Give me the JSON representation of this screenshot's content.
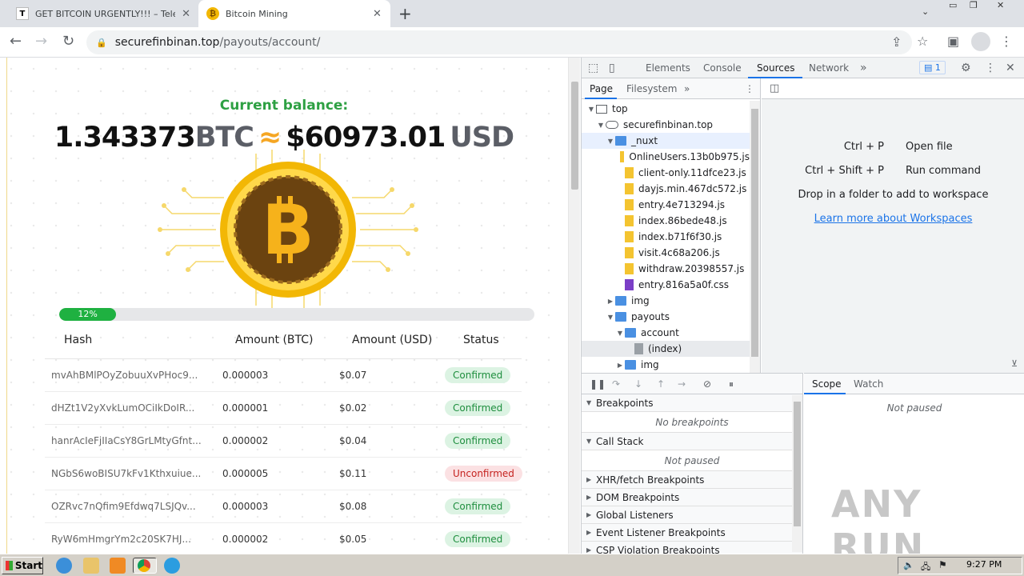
{
  "browser": {
    "tabs": [
      {
        "title": "GET BITCOIN URGENTLY!!! – Telegra",
        "favicon": "T"
      },
      {
        "title": "Bitcoin Mining",
        "favicon": "₿"
      }
    ],
    "url_host": "securefinbinan.top",
    "url_path": "/payouts/account/"
  },
  "page": {
    "balance_label": "Current balance:",
    "btc_amount": "1.343373",
    "btc_unit": "BTC",
    "approx": "≈",
    "usd_amount": "$60973.01",
    "usd_unit": "USD",
    "progress_label": "12%",
    "progress_fraction": 0.12,
    "table": {
      "headers": [
        "Hash",
        "Amount (BTC)",
        "Amount (USD)",
        "Status"
      ],
      "rows": [
        {
          "hash": "mvAhBMlPOyZobuuXvPHoc9...",
          "btc": "0.000003",
          "usd": "$0.07",
          "status": "Confirmed",
          "ok": true
        },
        {
          "hash": "dHZt1V2yXvkLumOCiIkDoIR...",
          "btc": "0.000001",
          "usd": "$0.02",
          "status": "Confirmed",
          "ok": true
        },
        {
          "hash": "hanrAcIeFjIIaCsY8GrLMtyGfnt...",
          "btc": "0.000002",
          "usd": "$0.04",
          "status": "Confirmed",
          "ok": true
        },
        {
          "hash": "NGbS6woBISU7kFv1Kthxuiue...",
          "btc": "0.000005",
          "usd": "$0.11",
          "status": "Unconfirmed",
          "ok": false
        },
        {
          "hash": "OZRvc7nQfim9Efdwq7LSJQv...",
          "btc": "0.000003",
          "usd": "$0.08",
          "status": "Confirmed",
          "ok": true
        },
        {
          "hash": "RyW6mHmgrYm2c20SK7HJ...",
          "btc": "0.000002",
          "usd": "$0.05",
          "status": "Confirmed",
          "ok": true
        }
      ]
    }
  },
  "devtools": {
    "tabs": [
      "Elements",
      "Console",
      "Sources",
      "Network"
    ],
    "selected_tab": "Sources",
    "issues_count": "1",
    "navigator_tabs": [
      "Page",
      "Filesystem"
    ],
    "tree": [
      {
        "label": "top",
        "depth": 0,
        "icon": "frame",
        "arrow": "▼"
      },
      {
        "label": "securefinbinan.top",
        "depth": 1,
        "icon": "cloud",
        "arrow": "▼"
      },
      {
        "label": "_nuxt",
        "depth": 2,
        "icon": "folder",
        "arrow": "▼",
        "highlight": true
      },
      {
        "label": "OnlineUsers.13b0b975.js",
        "depth": 3,
        "icon": "jsf",
        "arrow": ""
      },
      {
        "label": "client-only.11dfce23.js",
        "depth": 3,
        "icon": "jsf",
        "arrow": ""
      },
      {
        "label": "dayjs.min.467dc572.js",
        "depth": 3,
        "icon": "jsf",
        "arrow": ""
      },
      {
        "label": "entry.4e713294.js",
        "depth": 3,
        "icon": "jsf",
        "arrow": ""
      },
      {
        "label": "index.86bede48.js",
        "depth": 3,
        "icon": "jsf",
        "arrow": ""
      },
      {
        "label": "index.b71f6f30.js",
        "depth": 3,
        "icon": "jsf",
        "arrow": ""
      },
      {
        "label": "visit.4c68a206.js",
        "depth": 3,
        "icon": "jsf",
        "arrow": ""
      },
      {
        "label": "withdraw.20398557.js",
        "depth": 3,
        "icon": "jsf",
        "arrow": ""
      },
      {
        "label": "entry.816a5a0f.css",
        "depth": 3,
        "icon": "cssf",
        "arrow": ""
      },
      {
        "label": "img",
        "depth": 2,
        "icon": "folder",
        "arrow": "▶"
      },
      {
        "label": "payouts",
        "depth": 2,
        "icon": "folder",
        "arrow": "▼"
      },
      {
        "label": "account",
        "depth": 3,
        "icon": "folder",
        "arrow": "▼"
      },
      {
        "label": "(index)",
        "depth": 4,
        "icon": "doc",
        "arrow": "",
        "selected": true
      },
      {
        "label": "img",
        "depth": 3,
        "icon": "folder",
        "arrow": "▶"
      }
    ],
    "shortcuts": [
      {
        "key": "Ctrl + P",
        "action": "Open file"
      },
      {
        "key": "Ctrl + Shift + P",
        "action": "Run command"
      }
    ],
    "drop_text": "Drop in a folder to add to workspace",
    "learn_link": "Learn more about Workspaces",
    "breakpoints_title": "Breakpoints",
    "no_breakpoints": "No breakpoints",
    "call_stack_title": "Call Stack",
    "not_paused": "Not paused",
    "collapsed_sections": [
      "XHR/fetch Breakpoints",
      "DOM Breakpoints",
      "Global Listeners",
      "Event Listener Breakpoints",
      "CSP Violation Breakpoints"
    ],
    "scope_tabs": [
      "Scope",
      "Watch"
    ],
    "scope_not_paused": "Not paused",
    "watermark": "ANY RUN"
  },
  "taskbar": {
    "start_label": "Start",
    "clock": "9:27 PM"
  }
}
